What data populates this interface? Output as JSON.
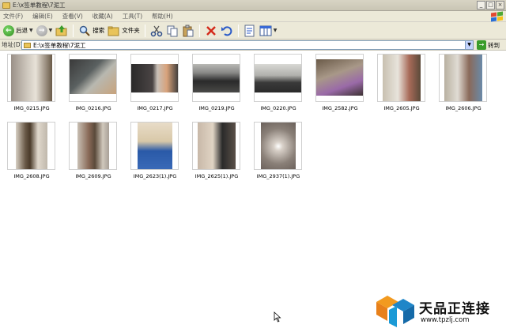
{
  "window": {
    "title": "E:\\x签单教程\\7泥工",
    "buttons": [
      "_",
      "□",
      "×"
    ]
  },
  "menu": [
    "文件(F)",
    "编辑(E)",
    "查看(V)",
    "收藏(A)",
    "工具(T)",
    "帮助(H)"
  ],
  "toolbar": {
    "back_label": "后退",
    "search_label": "搜索",
    "folders_label": "文件夹"
  },
  "address": {
    "label": "地址(D)",
    "value": "E:\\x签单教程\\7泥工",
    "go_label": "转到"
  },
  "files": [
    {
      "name": "IMG_0215.JPG"
    },
    {
      "name": "IMG_0216.JPG"
    },
    {
      "name": "IMG_0217.JPG"
    },
    {
      "name": "IMG_0219.JPG"
    },
    {
      "name": "IMG_0220.JPG"
    },
    {
      "name": "IMG_2582.JPG"
    },
    {
      "name": "IMG_2605.JPG"
    },
    {
      "name": "IMG_2606.JPG"
    },
    {
      "name": "IMG_2608.JPG"
    },
    {
      "name": "IMG_2609.JPG"
    },
    {
      "name": "IMG_2623(1).JPG"
    },
    {
      "name": "IMG_2625(1).JPG"
    },
    {
      "name": "IMG_2937(1).JPG"
    }
  ],
  "watermark": {
    "brand": "天品正连接",
    "url": "www.tpzlj.com"
  },
  "colors": {
    "chrome": "#ece9d8",
    "address_border": "#7f9db9",
    "folder": "#e9c45a"
  }
}
